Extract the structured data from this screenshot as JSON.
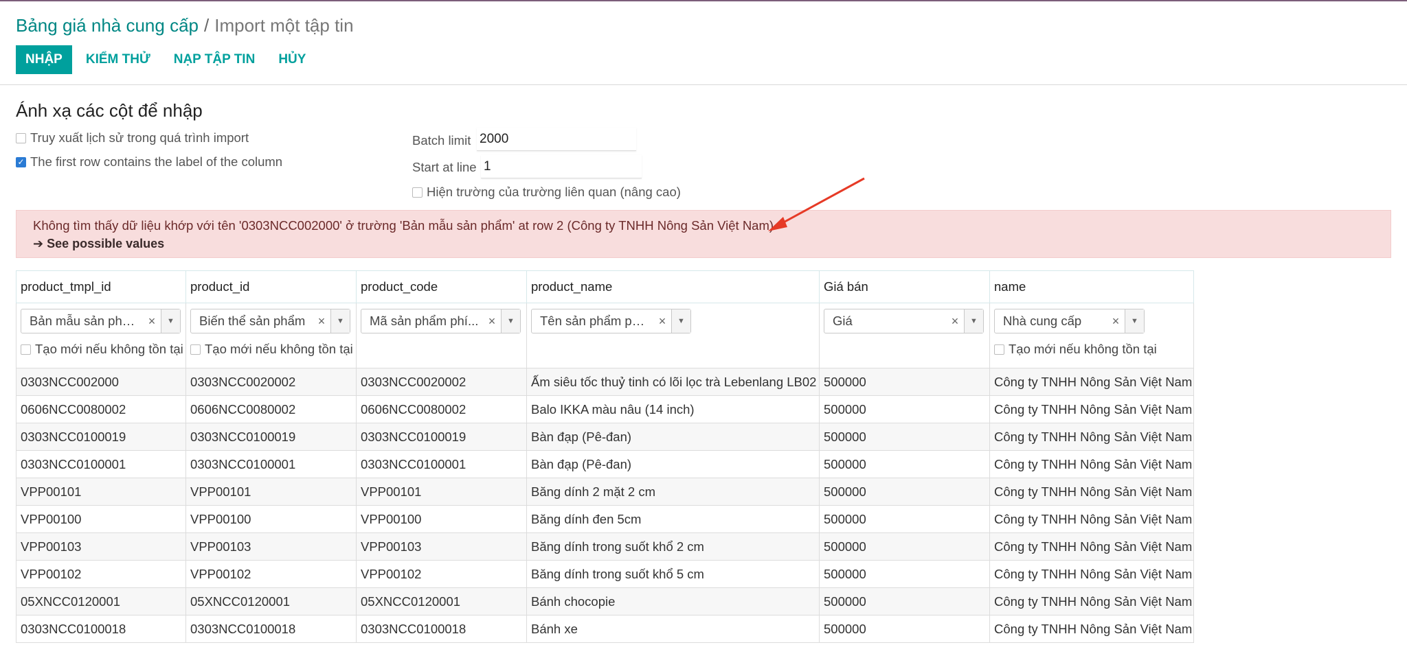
{
  "breadcrumb": {
    "parent": "Bảng giá nhà cung cấp",
    "separator": "/",
    "current": "Import một tập tin"
  },
  "buttons": {
    "import": "NHẬP",
    "test": "KIỂM THỬ",
    "load_file": "NẠP TẬP TIN",
    "cancel": "HỦY"
  },
  "section_title": "Ánh xạ các cột để nhập",
  "options": {
    "track_history": {
      "label": "Truy xuất lịch sử trong quá trình import",
      "checked": false
    },
    "first_row_header": {
      "label": "The first row contains the label of the column",
      "checked": true
    },
    "show_related": {
      "label": "Hiện trường của trường liên quan (nâng cao)",
      "checked": false
    }
  },
  "fields": {
    "batch_limit": {
      "label": "Batch limit",
      "value": "2000"
    },
    "start_at_line": {
      "label": "Start at line",
      "value": "1"
    }
  },
  "alert": {
    "message": "Không tìm thấy dữ liệu khớp với tên '0303NCC002000' ở trường 'Bản mẫu sản phẩm' at row 2 (Công ty TNHH Nông Sản Việt Nam)",
    "link": "See possible values",
    "color": "#f8dddd"
  },
  "create_if_missing_label": "Tạo mới nếu không tồn tại",
  "columns": [
    {
      "header": "product_tmpl_id",
      "mapping": "Bản mẫu sản phẩm",
      "create_option": true
    },
    {
      "header": "product_id",
      "mapping": "Biến thể sản phẩm",
      "create_option": true
    },
    {
      "header": "product_code",
      "mapping": "Mã sản phẩm phí...",
      "create_option": false
    },
    {
      "header": "product_name",
      "mapping": "Tên sản phẩm phí...",
      "create_option": false
    },
    {
      "header": "Giá bán",
      "mapping": "Giá",
      "create_option": false
    },
    {
      "header": "name",
      "mapping": "Nhà cung cấp",
      "create_option": true
    }
  ],
  "rows": [
    [
      "0303NCC002000",
      "0303NCC0020002",
      "0303NCC0020002",
      "Ấm siêu tốc thuỷ tinh có lõi lọc trà Lebenlang LB02",
      "500000",
      "Công ty TNHH Nông Sản Việt Nam"
    ],
    [
      "0606NCC0080002",
      "0606NCC0080002",
      "0606NCC0080002",
      "Balo IKKA màu nâu (14 inch)",
      "500000",
      "Công ty TNHH Nông Sản Việt Nam"
    ],
    [
      "0303NCC0100019",
      "0303NCC0100019",
      "0303NCC0100019",
      "Bàn đạp (Pê-đan)",
      "500000",
      "Công ty TNHH Nông Sản Việt Nam"
    ],
    [
      "0303NCC0100001",
      "0303NCC0100001",
      "0303NCC0100001",
      "Bàn đạp (Pê-đan)",
      "500000",
      "Công ty TNHH Nông Sản Việt Nam"
    ],
    [
      "VPP00101",
      "VPP00101",
      "VPP00101",
      "Băng dính 2 mặt 2 cm",
      "500000",
      "Công ty TNHH Nông Sản Việt Nam"
    ],
    [
      "VPP00100",
      "VPP00100",
      "VPP00100",
      "Băng dính đen 5cm",
      "500000",
      "Công ty TNHH Nông Sản Việt Nam"
    ],
    [
      "VPP00103",
      "VPP00103",
      "VPP00103",
      "Băng dính trong suốt khổ 2 cm",
      "500000",
      "Công ty TNHH Nông Sản Việt Nam"
    ],
    [
      "VPP00102",
      "VPP00102",
      "VPP00102",
      "Băng dính trong suốt khổ 5 cm",
      "500000",
      "Công ty TNHH Nông Sản Việt Nam"
    ],
    [
      "05XNCC0120001",
      "05XNCC0120001",
      "05XNCC0120001",
      "Bánh chocopie",
      "500000",
      "Công ty TNHH Nông Sản Việt Nam"
    ],
    [
      "0303NCC0100018",
      "0303NCC0100018",
      "0303NCC0100018",
      "Bánh xe",
      "500000",
      "Công ty TNHH Nông Sản Việt Nam"
    ]
  ],
  "colors": {
    "brand": "#00a09d",
    "annotation_arrow": "#e63a26"
  }
}
